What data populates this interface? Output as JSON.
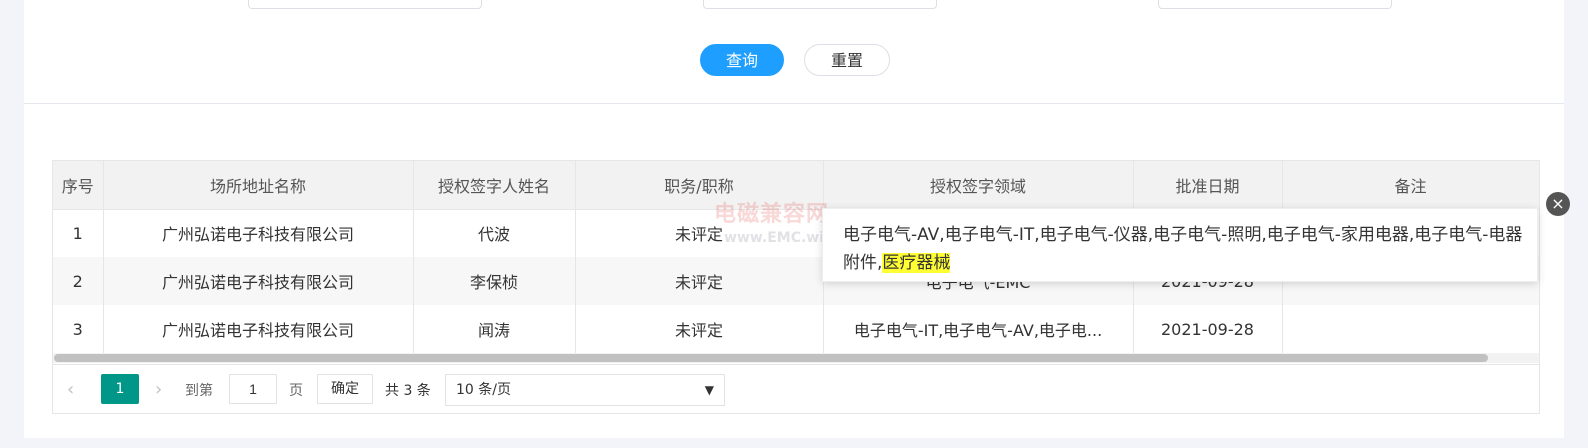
{
  "search": {
    "query_label": "查询",
    "reset_label": "重置"
  },
  "table": {
    "headers": [
      "序号",
      "场所地址名称",
      "授权签字人姓名",
      "职务/职称",
      "授权签字领域",
      "批准日期",
      "备注"
    ],
    "rows": [
      [
        "1",
        "广州弘诺电子科技有限公司",
        "代波",
        "未评定",
        "",
        "",
        ""
      ],
      [
        "2",
        "广州弘诺电子科技有限公司",
        "李保桢",
        "未评定",
        "电子电气-EMC",
        "2021-09-28",
        ""
      ],
      [
        "3",
        "广州弘诺电子科技有限公司",
        "闻涛",
        "未评定",
        "电子电气-IT,电子电气-AV,电子电...",
        "2021-09-28",
        ""
      ]
    ]
  },
  "tooltip": {
    "text": "电子电气-AV,电子电气-IT,电子电气-仪器,电子电气-照明,电子电气-家用电器,电子电气-电器附件,",
    "highlight": "医疗器械",
    "close_icon": "close-icon"
  },
  "watermark": {
    "title": "电磁兼容网",
    "url": "www.EMC.wiki"
  },
  "pagination": {
    "prev_icon": "chevron-left-icon",
    "current_page": "1",
    "next_icon": "chevron-right-icon",
    "goto_label": "到第",
    "goto_value": "1",
    "page_unit": "页",
    "confirm_label": "确定",
    "total_label": "共 3 条",
    "page_size": "10 条/页"
  }
}
